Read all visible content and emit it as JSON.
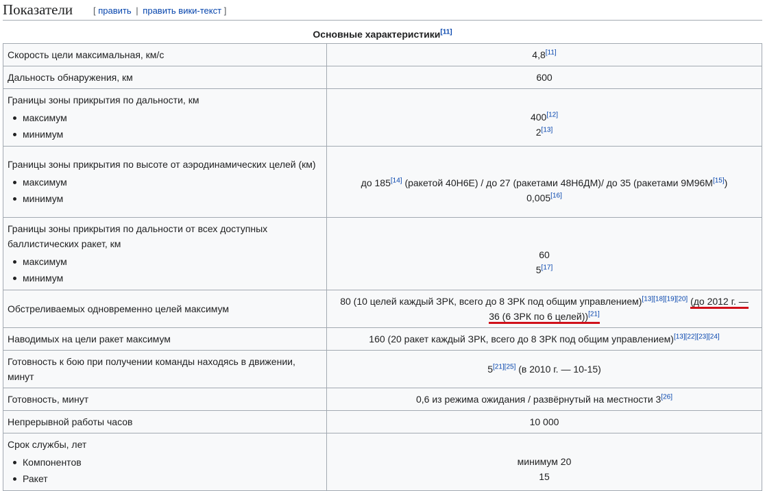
{
  "heading": {
    "title": "Показатели",
    "edit_open": "[",
    "edit_label": "править",
    "edit_sep": "|",
    "edit_wiki_label": "править вики-текст",
    "edit_close": "]"
  },
  "table": {
    "caption": "Основные характеристики",
    "caption_ref": "[11]",
    "rows": [
      {
        "label": "Скорость цели максимальная, км/с",
        "value": "4,8",
        "refs": [
          "[11]"
        ]
      },
      {
        "label": "Дальность обнаружения, км",
        "value": "600"
      },
      {
        "label": "Границы зоны прикрытия по дальности, км",
        "sub": [
          "максимум",
          "минимум"
        ],
        "values": [
          {
            "text": "400",
            "ref": "[12]"
          },
          {
            "text": "2",
            "ref": "[13]"
          }
        ]
      },
      {
        "label": "Границы зоны прикрытия по высоте от аэродинамических целей (км)",
        "sub": [
          "максимум",
          "минимум"
        ],
        "values": [
          {
            "a": "до 185",
            "ref_a": "[14]",
            "b": " (ракетой 40Н6Е) / до 27 (ракетами 48Н6ДМ)/ до 35 (ракетами 9М96М",
            "ref_b": "[15]",
            "c": ")"
          },
          {
            "text": "0,005",
            "ref": "[16]"
          }
        ]
      },
      {
        "label": "Границы зоны прикрытия по дальности от всех доступных баллистических ракет, км",
        "sub": [
          "максимум",
          "минимум"
        ],
        "values": [
          {
            "text": "60"
          },
          {
            "text": "5",
            "ref": "[17]"
          }
        ]
      },
      {
        "label": "Обстреливаемых одновременно целей максимум",
        "value_main": "80 (10 целей каждый ЗРК, всего до 8 ЗРК под общим управлением)",
        "refs": [
          "[13]",
          "[18]",
          "[19]",
          "[20]"
        ],
        "value_marked_1": "(до 2012 г. —",
        "value_marked_2": "36 (6 ЗРК по 6 целей))",
        "ref_end": "[21]"
      },
      {
        "label": "Наводимых на цели ракет максимум",
        "value": "160 (20 ракет каждый ЗРК, всего до 8 ЗРК под общим управлением)",
        "refs": [
          "[13]",
          "[22]",
          "[23]",
          "[24]"
        ]
      },
      {
        "label": "Готовность к бою при получении команды находясь в движении, минут",
        "value": "5",
        "refs": [
          "[21]",
          "[25]"
        ],
        "tail": " (в 2010 г. — 10-15)"
      },
      {
        "label": "Готовность, минут",
        "value": "0,6 из режима ожидания / развёрнутый на местности 3",
        "refs": [
          "[26]"
        ]
      },
      {
        "label": "Непрерывной работы часов",
        "value": "10 000"
      },
      {
        "label": "Срок службы, лет",
        "sub": [
          "Компонентов",
          "Ракет"
        ],
        "values": [
          {
            "text": "минимум 20"
          },
          {
            "text": "15"
          }
        ]
      }
    ]
  },
  "colors": {
    "link": "#0645ad",
    "table_bg": "#f8f9fa",
    "border": "#a2a9b1",
    "annotation_red": "#d0101a"
  }
}
